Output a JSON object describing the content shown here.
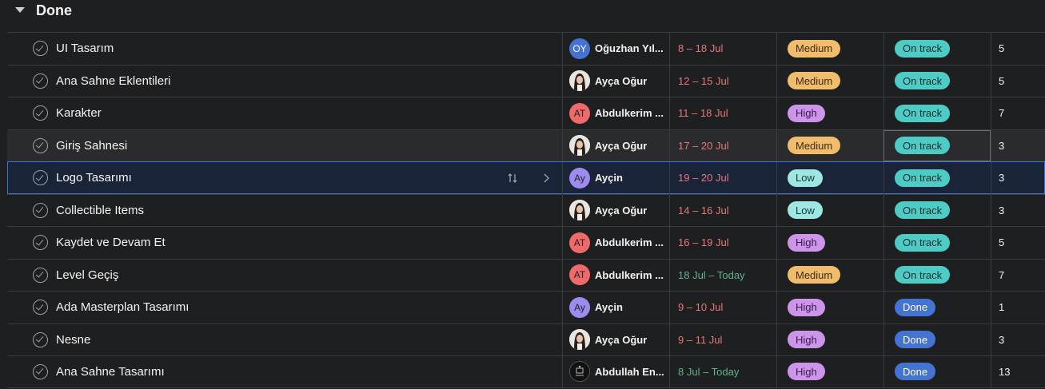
{
  "section": {
    "title": "Done"
  },
  "colors": {
    "background": "#1e1f21",
    "medium": "#f1bd6c",
    "high": "#cd95ea",
    "low": "#9ee7e3",
    "on_track": "#4ecbc4",
    "done": "#4573d2",
    "date_overdue": "#e8777b",
    "date_current": "#5fb38a"
  },
  "rows": [
    {
      "name": "UI Tasarım",
      "assignee": {
        "initials": "OY",
        "name": "Oğuzhan Yıl...",
        "avatar": "initials-blue"
      },
      "dates": "8 – 18 Jul",
      "date_tone": "red",
      "priority": "Medium",
      "status": "On track",
      "count": "5"
    },
    {
      "name": "Ana Sahne Eklentileri",
      "assignee": {
        "initials": "",
        "name": "Ayça Oğur",
        "avatar": "photo"
      },
      "dates": "12 – 15 Jul",
      "date_tone": "red",
      "priority": "Medium",
      "status": "On track",
      "count": "5"
    },
    {
      "name": "Karakter",
      "assignee": {
        "initials": "AT",
        "name": "Abdulkerim ...",
        "avatar": "initials-red"
      },
      "dates": "11 – 18 Jul",
      "date_tone": "red",
      "priority": "High",
      "status": "On track",
      "count": "7"
    },
    {
      "name": "Giriş Sahnesi",
      "assignee": {
        "initials": "",
        "name": "Ayça Oğur",
        "avatar": "photo"
      },
      "dates": "17 – 20 Jul",
      "date_tone": "red",
      "priority": "Medium",
      "status": "On track",
      "count": "3"
    },
    {
      "name": "Logo Tasarımı",
      "assignee": {
        "initials": "Ay",
        "name": "Ayçin",
        "avatar": "initials-purple"
      },
      "dates": "19 – 20 Jul",
      "date_tone": "red",
      "priority": "Low",
      "status": "On track",
      "count": "3"
    },
    {
      "name": "Collectible Items",
      "assignee": {
        "initials": "",
        "name": "Ayça Oğur",
        "avatar": "photo"
      },
      "dates": "14 – 16 Jul",
      "date_tone": "red",
      "priority": "Low",
      "status": "On track",
      "count": "3"
    },
    {
      "name": "Kaydet ve Devam Et",
      "assignee": {
        "initials": "AT",
        "name": "Abdulkerim ...",
        "avatar": "initials-red"
      },
      "dates": "16 – 19 Jul",
      "date_tone": "red",
      "priority": "High",
      "status": "On track",
      "count": "5"
    },
    {
      "name": "Level Geçiş",
      "assignee": {
        "initials": "AT",
        "name": "Abdulkerim ...",
        "avatar": "initials-red"
      },
      "dates": "18 Jul – Today",
      "date_tone": "green",
      "priority": "Medium",
      "status": "On track",
      "count": "7"
    },
    {
      "name": "Ada Masterplan Tasarımı",
      "assignee": {
        "initials": "Ay",
        "name": "Ayçin",
        "avatar": "initials-purple"
      },
      "dates": "9 – 10 Jul",
      "date_tone": "red",
      "priority": "High",
      "status": "Done",
      "count": "1"
    },
    {
      "name": "Nesne",
      "assignee": {
        "initials": "",
        "name": "Ayça Oğur",
        "avatar": "photo"
      },
      "dates": "9 – 11 Jul",
      "date_tone": "red",
      "priority": "High",
      "status": "Done",
      "count": "3"
    },
    {
      "name": "Ana Sahne Tasarımı",
      "assignee": {
        "initials": "",
        "name": "Abdullah En...",
        "avatar": "dark-logo"
      },
      "dates": "8 Jul – Today",
      "date_tone": "green",
      "priority": "High",
      "status": "Done",
      "count": "13"
    }
  ]
}
